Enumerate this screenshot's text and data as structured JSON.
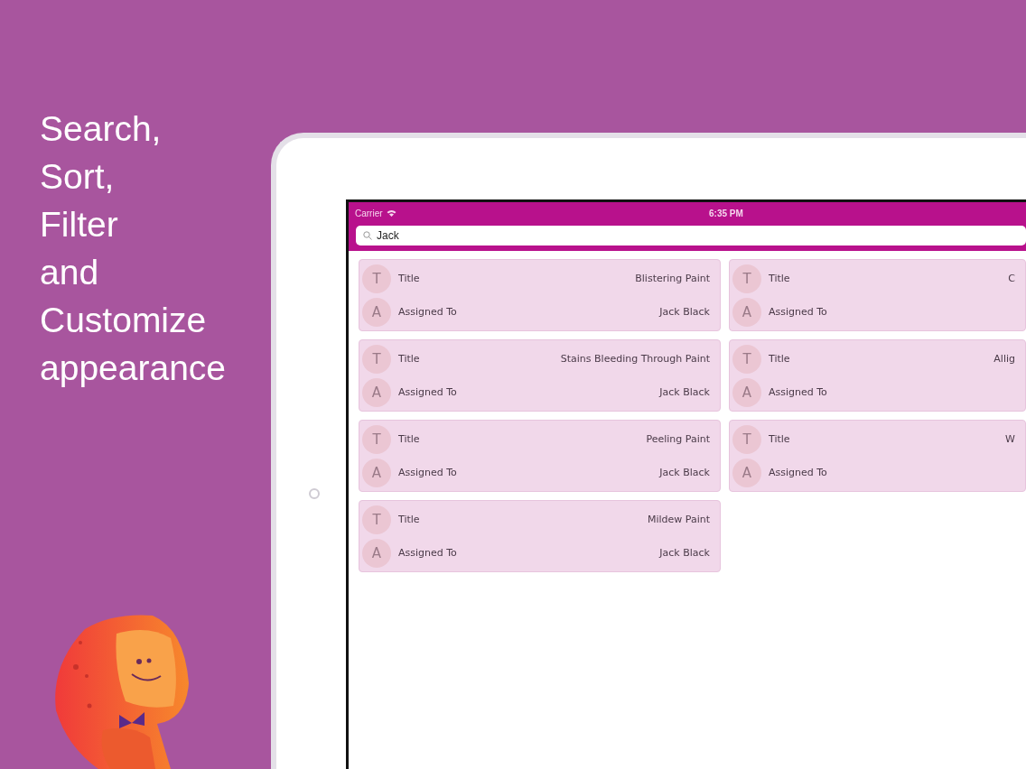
{
  "headline": [
    "Search,",
    "Sort,",
    "Filter",
    "and",
    "Customize",
    "appearance"
  ],
  "status_bar": {
    "carrier": "Carrier",
    "time": "6:35 PM"
  },
  "search": {
    "value": "Jack"
  },
  "cards": [
    {
      "fields": [
        {
          "letter": "T",
          "label": "Title",
          "value": "Blistering Paint"
        },
        {
          "letter": "A",
          "label": "Assigned To",
          "value": "Jack Black"
        }
      ]
    },
    {
      "fields": [
        {
          "letter": "T",
          "label": "Title",
          "value": "C"
        },
        {
          "letter": "A",
          "label": "Assigned To"
        }
      ]
    },
    {
      "fields": [
        {
          "letter": "T",
          "label": "Title",
          "value": "Stains Bleeding Through Paint"
        },
        {
          "letter": "A",
          "label": "Assigned To",
          "value": "Jack Black"
        }
      ]
    },
    {
      "fields": [
        {
          "letter": "T",
          "label": "Title",
          "value": "Allig"
        },
        {
          "letter": "A",
          "label": "Assigned To"
        }
      ]
    },
    {
      "fields": [
        {
          "letter": "T",
          "label": "Title",
          "value": "Peeling Paint"
        },
        {
          "letter": "A",
          "label": "Assigned To",
          "value": "Jack Black"
        }
      ]
    },
    {
      "fields": [
        {
          "letter": "T",
          "label": "Title",
          "value": "W"
        },
        {
          "letter": "A",
          "label": "Assigned To"
        }
      ]
    },
    {
      "fields": [
        {
          "letter": "T",
          "label": "Title",
          "value": "Mildew Paint"
        },
        {
          "letter": "A",
          "label": "Assigned To",
          "value": "Jack Black"
        }
      ]
    }
  ]
}
